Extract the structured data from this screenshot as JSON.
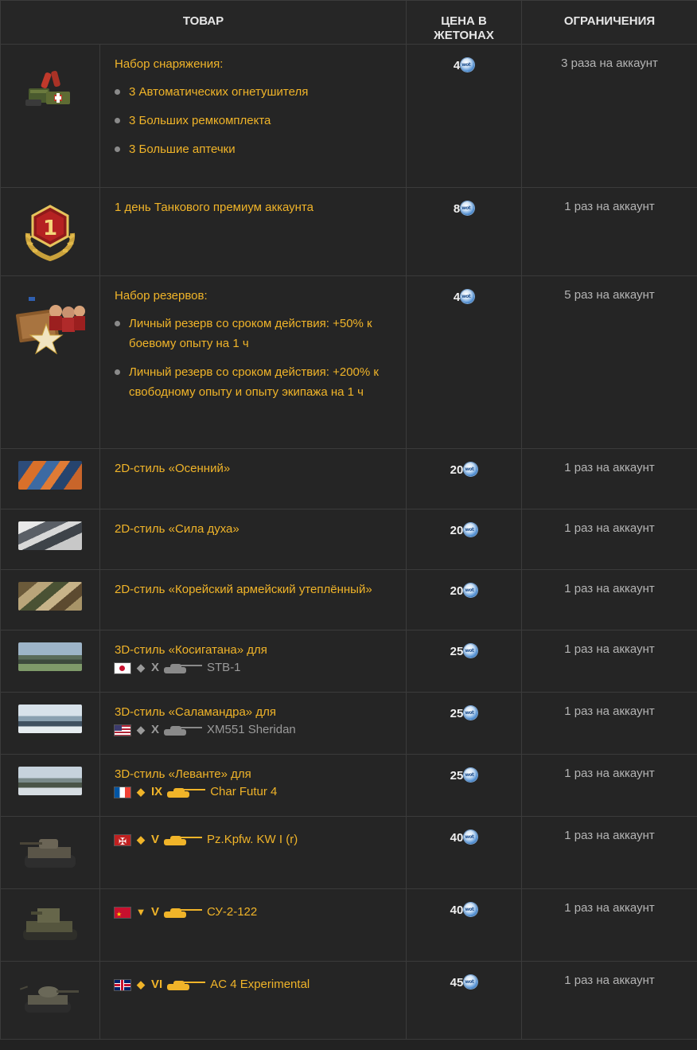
{
  "header": {
    "item": "ТОВАР",
    "price_line1": "ЦЕНА В",
    "price_line2": "ЖЕТОНАХ",
    "limits": "ОГРАНИЧЕНИЯ"
  },
  "rows": [
    {
      "title": "Набор снаряжения:",
      "bullets": [
        "3 Автоматических огнетушителя",
        "3 Больших ремкомплекта",
        "3 Большие аптечки"
      ],
      "price": "4",
      "limit": "3 раза на аккаунт",
      "icon": "equipment-kit-icon"
    },
    {
      "title": "1 день Танкового премиум аккаунта",
      "price": "8",
      "limit": "1 раз на аккаунт",
      "icon": "premium-day-badge-icon",
      "badge_number": "1"
    },
    {
      "title": "Набор резервов:",
      "bullets": [
        "Личный резерв со сроком действия: +50% к боевому опыту на 1 ч",
        "Личный резерв со сроком действия: +200% к свободному опыту и опыту экипажа на 1 ч"
      ],
      "price": "4",
      "limit": "5 раз на аккаунт",
      "icon": "reserves-icon"
    },
    {
      "title": "2D-стиль «Осенний»",
      "price": "20",
      "limit": "1 раз на аккаунт",
      "icon": "camo-autumn-icon"
    },
    {
      "title": "2D-стиль «Сила духа»",
      "price": "20",
      "limit": "1 раз на аккаунт",
      "icon": "camo-spirit-icon"
    },
    {
      "title": "2D-стиль «Корейский армейский утеплённый»",
      "price": "20",
      "limit": "1 раз на аккаунт",
      "icon": "camo-korean-icon"
    },
    {
      "title": "3D-стиль «Косигатана» для",
      "vehicle": {
        "flag": "japan-flag-icon",
        "class": "◆",
        "tier": "X",
        "name": "STB-1",
        "tone": "gray"
      },
      "price": "25",
      "limit": "1 раз на аккаунт",
      "icon": "style-3d-kosigatana-icon"
    },
    {
      "title": "3D-стиль «Саламандра» для",
      "vehicle": {
        "flag": "usa-flag-icon",
        "class": "◆",
        "tier": "X",
        "name": "XM551 Sheridan",
        "tone": "gray"
      },
      "price": "25",
      "limit": "1 раз на аккаунт",
      "icon": "style-3d-salamander-icon"
    },
    {
      "title": "3D-стиль «Леванте» для",
      "vehicle": {
        "flag": "france-flag-icon",
        "class": "◆",
        "tier": "IX",
        "name": "Char Futur 4",
        "tone": "gold"
      },
      "price": "25",
      "limit": "1 раз на аккаунт",
      "icon": "style-3d-levante-icon"
    },
    {
      "vehicle": {
        "flag": "germany-flag-icon",
        "class": "◆",
        "tier": "V",
        "name": "Pz.Kpfw. KW I (r)",
        "tone": "gold"
      },
      "price": "40",
      "limit": "1 раз на аккаунт",
      "icon": "tank-kw1r-icon"
    },
    {
      "vehicle": {
        "flag": "ussr-flag-icon",
        "class": "▼",
        "tier": "V",
        "name": "СУ-2-122",
        "tone": "gold"
      },
      "price": "40",
      "limit": "1 раз на аккаунт",
      "icon": "tank-su2122-icon"
    },
    {
      "vehicle": {
        "flag": "uk-flag-icon",
        "class": "◆",
        "tier": "VI",
        "name": "AC 4 Experimental",
        "tone": "gold"
      },
      "price": "45",
      "limit": "1 раз на аккаунт",
      "icon": "tank-ac4-icon"
    }
  ],
  "token_icon": "token-icon",
  "colors": {
    "accent": "#f0b429",
    "background": "#222222",
    "border": "#3b3b3b",
    "muted_text": "#b4b4b4"
  }
}
